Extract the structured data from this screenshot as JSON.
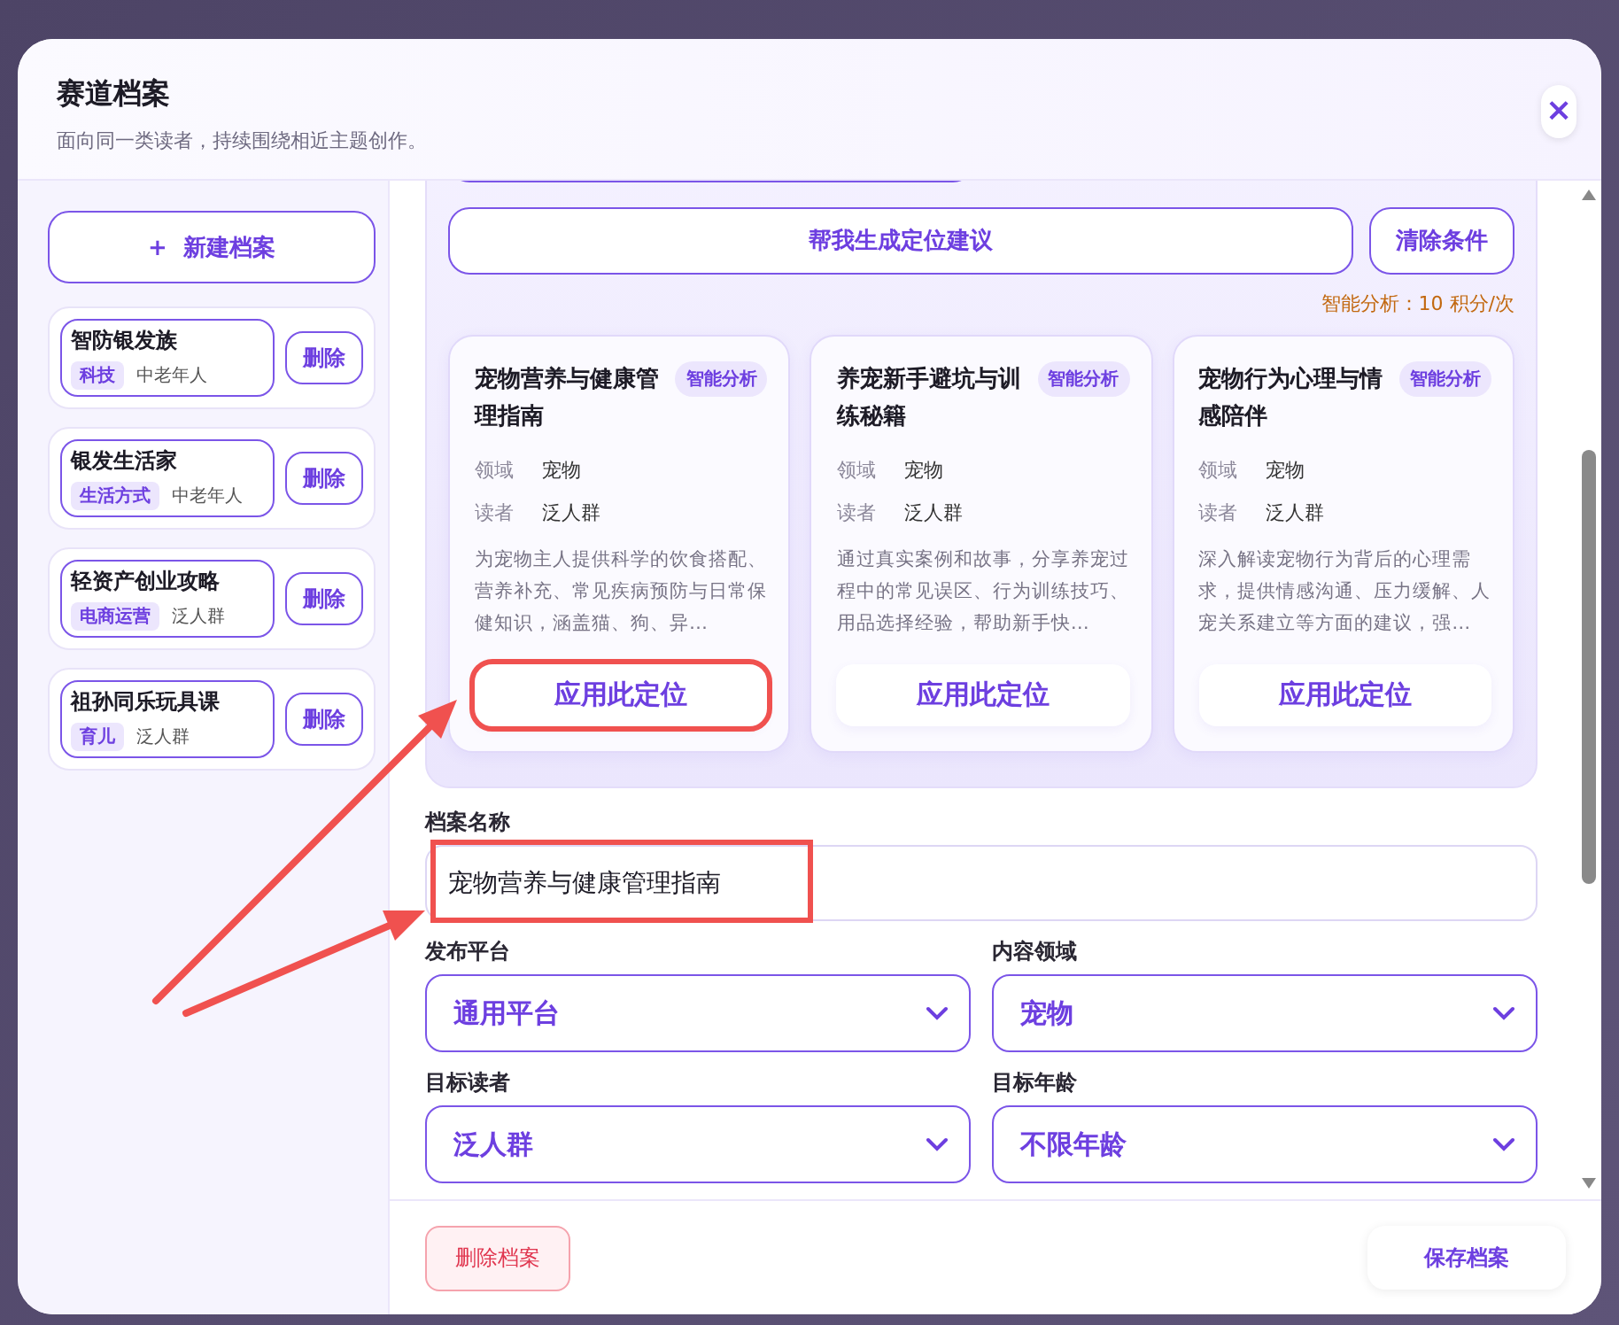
{
  "window": {
    "title": "赛道档案",
    "subtitle": "面向同一类读者，持续围绕相近主题创作。",
    "close": "×"
  },
  "sidebar": {
    "new_button": "+  新建档案",
    "profiles": [
      {
        "name": "智防银发族",
        "tag": "科技",
        "audience": "中老年人",
        "delete": "删除"
      },
      {
        "name": "银发生活家",
        "tag": "生活方式",
        "audience": "中老年人",
        "delete": "删除"
      },
      {
        "name": "轻资产创业攻略",
        "tag": "电商运营",
        "audience": "泛人群",
        "delete": "删除"
      },
      {
        "name": "祖孙同乐玩具课",
        "tag": "育儿",
        "audience": "泛人群",
        "delete": "删除"
      }
    ]
  },
  "suggest": {
    "generate_button": "帮我生成定位建议",
    "clear_button": "清除条件",
    "cost": "智能分析：10 积分/次",
    "cards": [
      {
        "title": "宠物营养与健康管理指南",
        "badge": "智能分析",
        "fields": [
          {
            "label": "领域",
            "value": "宠物"
          },
          {
            "label": "读者",
            "value": "泛人群"
          }
        ],
        "description": "为宠物主人提供科学的饮食搭配、营养补充、常见疾病预防与日常保健知识，涵盖猫、狗、异…",
        "apply": "应用此定位",
        "highlighted": true
      },
      {
        "title": "养宠新手避坑与训练秘籍",
        "badge": "智能分析",
        "fields": [
          {
            "label": "领域",
            "value": "宠物"
          },
          {
            "label": "读者",
            "value": "泛人群"
          }
        ],
        "description": "通过真实案例和故事，分享养宠过程中的常见误区、行为训练技巧、用品选择经验，帮助新手快…",
        "apply": "应用此定位",
        "highlighted": false
      },
      {
        "title": "宠物行为心理与情感陪伴",
        "badge": "智能分析",
        "fields": [
          {
            "label": "领域",
            "value": "宠物"
          },
          {
            "label": "读者",
            "value": "泛人群"
          }
        ],
        "description": "深入解读宠物行为背后的心理需求，提供情感沟通、压力缓解、人宠关系建立等方面的建议，强…",
        "apply": "应用此定位",
        "highlighted": false
      }
    ]
  },
  "form": {
    "name_label": "档案名称",
    "name_value": "宠物营养与健康管理指南",
    "name_highlighted": true,
    "selects": [
      {
        "label": "发布平台",
        "value": "通用平台"
      },
      {
        "label": "内容领域",
        "value": "宠物"
      },
      {
        "label": "目标读者",
        "value": "泛人群"
      },
      {
        "label": "目标年龄",
        "value": "不限年龄"
      }
    ]
  },
  "footer": {
    "delete_button": "删除档案",
    "save_button": "保存档案"
  }
}
